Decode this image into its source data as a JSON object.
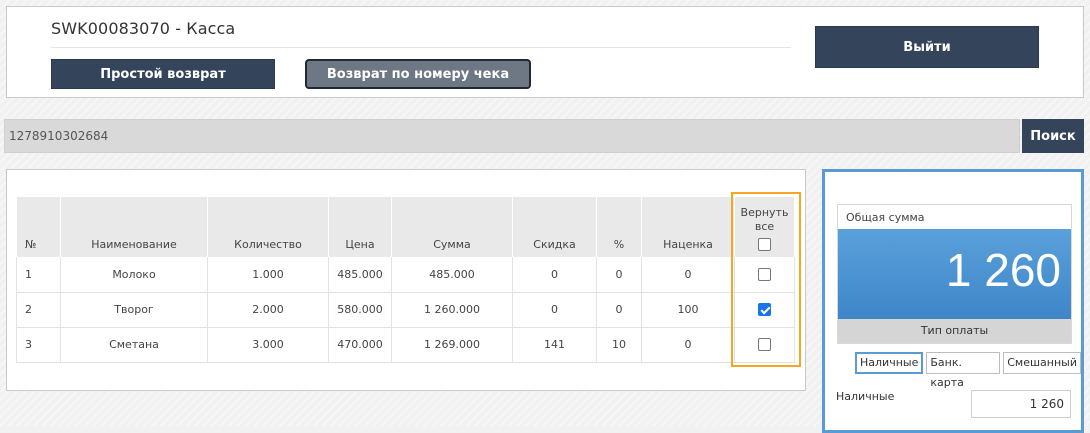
{
  "header": {
    "title": "SWK00083070 - Касса",
    "simple_return_label": "Простой возврат",
    "receipt_return_label": "Возврат по номеру чека",
    "exit_label": "Выйти"
  },
  "search": {
    "value": "1278910302684",
    "button_label": "Поиск"
  },
  "table": {
    "headers": {
      "num": "№",
      "name": "Наименование",
      "qty": "Количество",
      "price": "Цена",
      "sum": "Сумма",
      "discount": "Скидка",
      "percent": "%",
      "markup": "Наценка",
      "return_all": "Вернуть все"
    },
    "rows": [
      {
        "num": "1",
        "name": "Молоко",
        "qty": "1.000",
        "price": "485.000",
        "sum": "485.000",
        "discount": "0",
        "percent": "0",
        "markup": "0",
        "checked": false
      },
      {
        "num": "2",
        "name": "Творог",
        "qty": "2.000",
        "price": "580.000",
        "sum": "1 260.000",
        "discount": "0",
        "percent": "0",
        "markup": "100",
        "checked": true
      },
      {
        "num": "3",
        "name": "Сметана",
        "qty": "3.000",
        "price": "470.000",
        "sum": "1 269.000",
        "discount": "141",
        "percent": "10",
        "markup": "0",
        "checked": false
      }
    ],
    "return_all_checked": false
  },
  "summary": {
    "total_label": "Общая сумма",
    "total_value": "1 260",
    "payment_type_label": "Тип оплаты",
    "payment_tabs": [
      "Наличные",
      "Банк. карта",
      "Смешанный"
    ],
    "active_tab": "Наличные",
    "cash_label": "Наличные",
    "cash_value": "1 260"
  },
  "colors": {
    "dark_button": "#34445a",
    "highlight_orange": "#f5a623",
    "accent_blue": "#5b9bd5",
    "checkbox_blue": "#1a73e8"
  }
}
